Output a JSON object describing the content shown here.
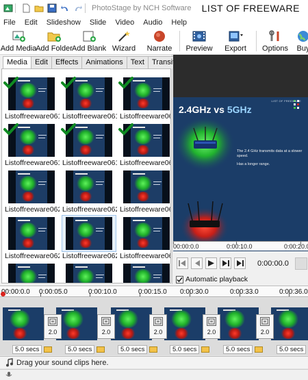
{
  "app": {
    "title": "PhotoStage by NCH Software",
    "watermark": "LIST OF FREEWARE"
  },
  "menu": [
    "File",
    "Edit",
    "Slideshow",
    "Slide",
    "Video",
    "Audio",
    "Help"
  ],
  "toolbar": {
    "add_media": "Add Media",
    "add_folder": "Add Folder",
    "add_blank": "Add Blank",
    "wizard": "Wizard",
    "narrate": "Narrate",
    "preview": "Preview",
    "export": "Export",
    "options": "Options",
    "buy": "Buy"
  },
  "tabs": [
    "Media",
    "Edit",
    "Effects",
    "Animations",
    "Text",
    "Transitions"
  ],
  "active_tab": "Media",
  "media_items": [
    {
      "label": "Listoffreeware061...",
      "checked": true
    },
    {
      "label": "Listoffreeware061...",
      "checked": true
    },
    {
      "label": "Listoffreeware061...",
      "checked": true
    },
    {
      "label": "Listoffreeware061...",
      "checked": true
    },
    {
      "label": "Listoffreeware061...",
      "checked": true
    },
    {
      "label": "Listoffreeware061...",
      "checked": true
    },
    {
      "label": "Listoffreeware062...",
      "checked": false
    },
    {
      "label": "Listoffreeware062...",
      "checked": false
    },
    {
      "label": "Listoffreeware062.",
      "checked": false
    },
    {
      "label": "Listoffreeware062...",
      "checked": false
    },
    {
      "label": "Listoffreeware062...",
      "checked": false,
      "selected": true
    },
    {
      "label": "Listoffreeware062...",
      "checked": false
    },
    {
      "label": "",
      "checked": false
    },
    {
      "label": "",
      "checked": false
    },
    {
      "label": "",
      "checked": false
    }
  ],
  "preview": {
    "slide_title_part1": "2.4GHz",
    "slide_title_vs": " vs ",
    "slide_title_part2": "5GHz",
    "slide_logo": "LIST OF FREEWARE",
    "slide_text1": "The 2.4 GHz transmits data at a slower",
    "slide_text2": "speed.",
    "slide_text3": "Has a longer range.",
    "ruler": [
      "00:00:0.0",
      "0:00:10.0",
      "0:00:20.0"
    ],
    "timecode": "0:00:00.0",
    "autoplay_label": "Automatic playback",
    "autoplay_checked": true
  },
  "timeline": {
    "ruler": [
      "00:00:0.0",
      "0:00:05.0",
      "0:00:10.0",
      "0:00:15.0",
      "0:00:30.0",
      "0:00:33.0",
      "0:00:36.0"
    ],
    "transitions": [
      "2.0",
      "2.0",
      "2.0",
      "2.0",
      "2.0",
      "2.0"
    ],
    "durations": [
      "5.0 secs",
      "5.0 secs",
      "5.0 secs",
      "5.0 secs",
      "5.0 secs",
      "5.0 secs"
    ],
    "audio_hint": "Drag your sound clips here."
  },
  "colors": {
    "slide_bg": "#1b3d68",
    "accent_green": "#2fc13a",
    "accent_red": "#d62a20",
    "playhead": "#d9231d"
  }
}
